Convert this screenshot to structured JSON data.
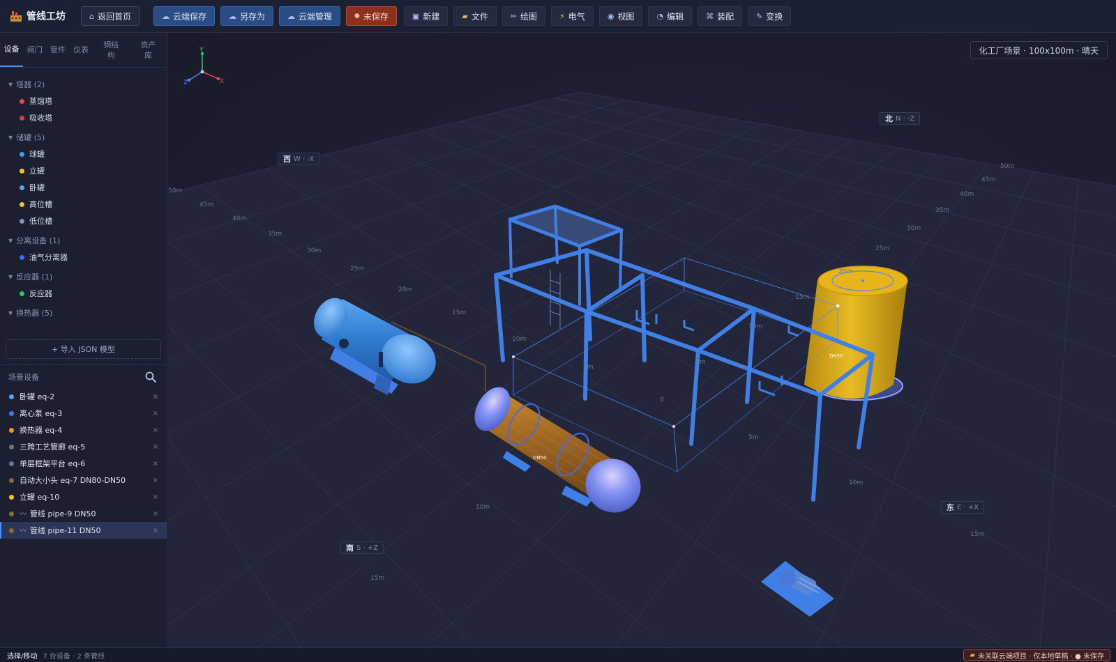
{
  "app": {
    "title": "管线工坊",
    "logo_icon": "factory-icon"
  },
  "toolbar": {
    "home": "返回首页",
    "cloud_save": "云端保存",
    "save_as": "另存为",
    "cloud_manage": "云端管理",
    "unsaved": "未保存",
    "new": "新建",
    "file": "文件",
    "draw": "绘图",
    "electrical": "电气",
    "view": "视图",
    "edit": "编辑",
    "assembly": "装配",
    "transform": "变换"
  },
  "sidebar": {
    "tabs": [
      {
        "label": "设备",
        "active": true
      },
      {
        "label": "阀门"
      },
      {
        "label": "管件"
      },
      {
        "label": "仪表"
      },
      {
        "label": "钢结构"
      },
      {
        "label": "资产库"
      }
    ],
    "groups": [
      {
        "label": "塔器 (2)",
        "items": [
          {
            "label": "蒸馏塔",
            "color": "#e34b48"
          },
          {
            "label": "吸收塔",
            "color": "#d0453f"
          }
        ]
      },
      {
        "label": "储罐 (5)",
        "items": [
          {
            "label": "球罐",
            "color": "#4a9bf0"
          },
          {
            "label": "立罐",
            "color": "#f0c330"
          },
          {
            "label": "卧罐",
            "color": "#5aa2ee"
          },
          {
            "label": "高位槽",
            "color": "#f0c330"
          },
          {
            "label": "低位槽",
            "color": "#8b93a8"
          }
        ]
      },
      {
        "label": "分离设备 (1)",
        "items": [
          {
            "label": "油气分离器",
            "color": "#3b6ff0"
          }
        ]
      },
      {
        "label": "反应器 (1)",
        "items": [
          {
            "label": "反应器",
            "color": "#35c46a"
          }
        ]
      },
      {
        "label": "换热器 (5)",
        "items": []
      }
    ],
    "import_button": "+ 导入 JSON 模型",
    "scene_title": "场景设备",
    "scene_items": [
      {
        "label": "卧罐 eq-2",
        "color": "#5aa2ee"
      },
      {
        "label": "离心泵 eq-3",
        "color": "#3d7fd6"
      },
      {
        "label": "换热器 eq-4",
        "color": "#e2a028"
      },
      {
        "label": "三跨工艺管廊 eq-5",
        "color": "#6b7590"
      },
      {
        "label": "单层框架平台 eq-6",
        "color": "#6b7590"
      },
      {
        "label": "自动大小头 eq-7 DN80-DN50",
        "color": "#8a6a3a"
      },
      {
        "label": "立罐 eq-10",
        "color": "#f0c330"
      },
      {
        "label": "管线 pipe-9 DN50",
        "color": "#8a6a3a",
        "pipe": true
      },
      {
        "label": "管线 pipe-11 DN50",
        "color": "#8a6a3a",
        "pipe": true,
        "selected": true
      }
    ],
    "close_glyph": "×"
  },
  "viewport": {
    "scene_badge": "化工厂场景 · 100x100m · 晴天",
    "axis_labels": {
      "x": "X",
      "y": "Y",
      "z": "Z"
    },
    "compass": {
      "north": {
        "cn": "北",
        "dir": "N · -Z"
      },
      "west": {
        "cn": "西",
        "dir": "W · -X"
      },
      "east": {
        "cn": "东",
        "dir": "E · +X"
      },
      "south": {
        "cn": "南",
        "dir": "S · +Z"
      }
    },
    "ticks_left": [
      "50m",
      "45m",
      "40m",
      "35m",
      "30m",
      "25m",
      "20m",
      "15m",
      "10m"
    ],
    "ticks_right": [
      "50m",
      "45m",
      "40m",
      "35m",
      "30m",
      "25m",
      "20m",
      "15m",
      "10m"
    ],
    "ticks_front": [
      "5m",
      "10m",
      "15m"
    ],
    "ticks_east": [
      "10m",
      "15m"
    ],
    "ticks_inner": [
      "5m",
      "5m",
      "5m",
      "0"
    ],
    "equipment_labels": {
      "exchanger": "DN50",
      "tank": "DN50"
    }
  },
  "status": {
    "mode": "选择/移动",
    "counts": "7 台设备 · 2 条管线",
    "cloud": "未关联云端项目 · 仅本地草稿 · ● 未保存"
  },
  "colors": {
    "accent": "#4a8dff",
    "steel": "#3f7fe6",
    "tank_yellow": "#e0b21c",
    "exchanger_brown": "#9a6322",
    "vessel_blue": "#3f8fe8",
    "unsaved_red": "#c4472c"
  }
}
